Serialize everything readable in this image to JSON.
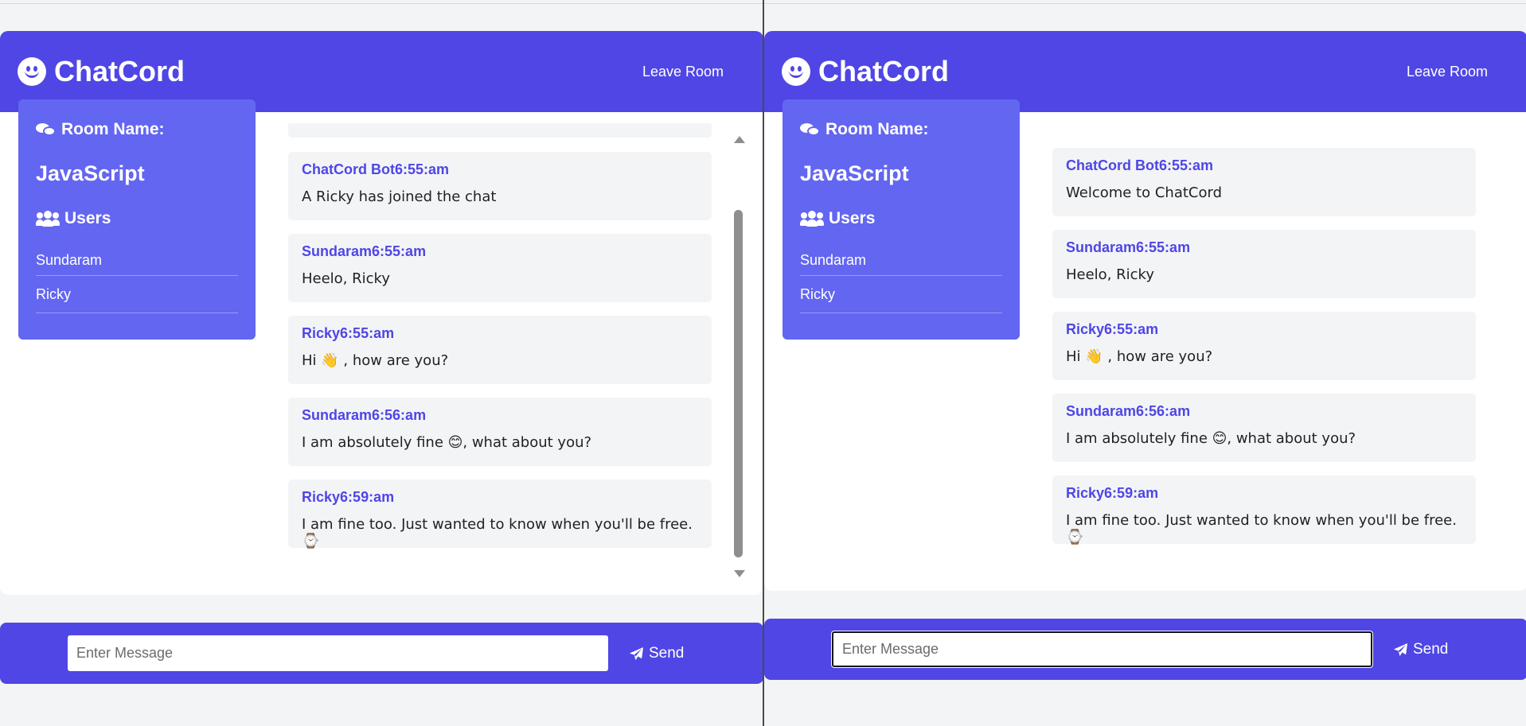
{
  "app": {
    "brand": "ChatCord",
    "leave_label": "Leave Room",
    "brand_color": "#4f46e5",
    "sidebar_color": "#6366f1"
  },
  "sidebar": {
    "room_heading": "Room Name:",
    "room_name": "JavaScript",
    "users_heading": "Users",
    "users": [
      "Sundaram",
      "Ricky"
    ]
  },
  "left_pane": {
    "messages": [
      {
        "user": "ChatCord Bot",
        "time": "6:55:am",
        "text": "A Ricky has joined the chat"
      },
      {
        "user": "Sundaram",
        "time": "6:55:am",
        "text": "Heelo, Ricky"
      },
      {
        "user": "Ricky",
        "time": "6:55:am",
        "text": "Hi 👋 , how are you?"
      },
      {
        "user": "Sundaram",
        "time": "6:56:am",
        "text": "I am absolutely fine 😊, what about you?"
      },
      {
        "user": "Ricky",
        "time": "6:59:am",
        "text": "I am fine too. Just wanted to know when you'll be free. ⌚"
      }
    ]
  },
  "right_pane": {
    "messages": [
      {
        "user": "ChatCord Bot",
        "time": "6:55:am",
        "text": "Welcome to ChatCord"
      },
      {
        "user": "Sundaram",
        "time": "6:55:am",
        "text": "Heelo, Ricky"
      },
      {
        "user": "Ricky",
        "time": "6:55:am",
        "text": "Hi 👋 , how are you?"
      },
      {
        "user": "Sundaram",
        "time": "6:56:am",
        "text": "I am absolutely fine 😊, what about you?"
      },
      {
        "user": "Ricky",
        "time": "6:59:am",
        "text": "I am fine too. Just wanted to know when you'll be free. ⌚"
      }
    ]
  },
  "form": {
    "placeholder": "Enter Message",
    "send_label": "Send"
  }
}
